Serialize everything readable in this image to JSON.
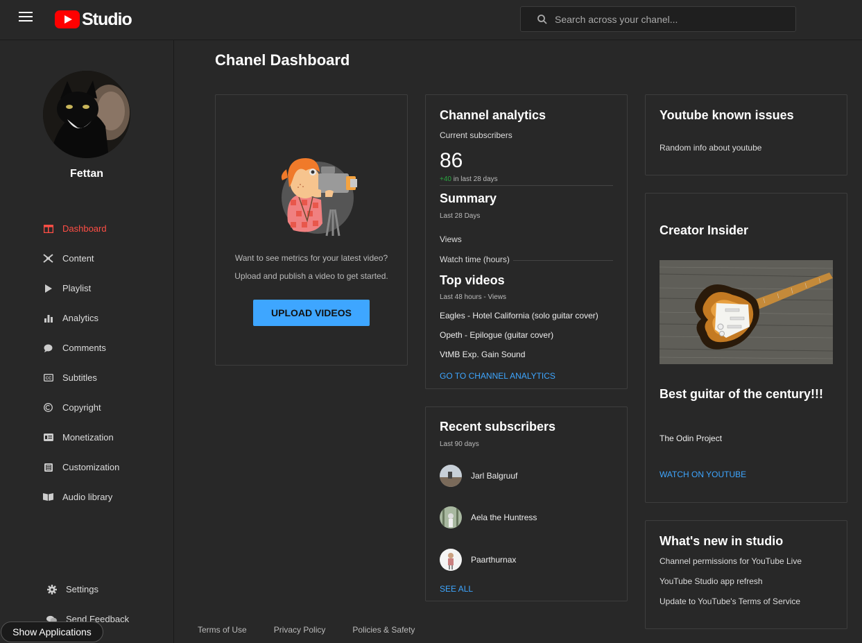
{
  "app": {
    "logo_word": "Studio"
  },
  "search": {
    "placeholder": "Search across your chanel..."
  },
  "sidebar": {
    "username": "Fettan",
    "items": [
      {
        "label": "Dashboard",
        "icon": "dashboard-icon",
        "active": true
      },
      {
        "label": "Content",
        "icon": "content-icon"
      },
      {
        "label": "Playlist",
        "icon": "playlist-icon"
      },
      {
        "label": "Analytics",
        "icon": "analytics-icon"
      },
      {
        "label": "Comments",
        "icon": "comments-icon"
      },
      {
        "label": "Subtitles",
        "icon": "subtitles-icon"
      },
      {
        "label": "Copyright",
        "icon": "copyright-icon"
      },
      {
        "label": "Monetization",
        "icon": "monetization-icon"
      },
      {
        "label": "Customization",
        "icon": "customization-icon"
      },
      {
        "label": "Audio library",
        "icon": "audio-library-icon"
      }
    ],
    "bottom_items": [
      {
        "label": "Settings",
        "icon": "gear-icon"
      },
      {
        "label": "Send Feedback",
        "icon": "feedback-icon"
      }
    ],
    "show_apps": "Show Applications"
  },
  "main": {
    "title": "Chanel Dashboard",
    "upload": {
      "line1": "Want to see metrics for your latest video?",
      "line2": "Upload and publish a video to get started.",
      "button": "UPLOAD VIDEOS"
    },
    "analytics": {
      "title": "Channel analytics",
      "subs_label": "Current subscribers",
      "subs_value": "86",
      "subs_delta": "+40",
      "subs_period": "in last 28 days",
      "summary_title": "Summary",
      "summary_period": "Last 28 Days",
      "views_label": "Views",
      "watch_label": "Watch time (hours)",
      "top_title": "Top videos",
      "top_period": "Last 48 hours - Views",
      "top_videos": [
        "Eagles - Hotel California (solo guitar cover)",
        "Opeth - Epilogue (guitar cover)",
        "VtMB Exp. Gain Sound"
      ],
      "link": "GO TO CHANNEL ANALYTICS"
    },
    "recent": {
      "title": "Recent subscribers",
      "period": "Last 90 days",
      "subscribers": [
        "Jarl Balgruuf",
        "Aela the Huntress",
        "Paarthurnax"
      ],
      "link": "SEE ALL"
    },
    "issues": {
      "title": "Youtube known issues",
      "text": "Random info about youtube"
    },
    "creator": {
      "title": "Creator Insider",
      "headline": "Best guitar of the century!!!",
      "source": "The Odin Project",
      "link": "WATCH ON YOUTUBE"
    },
    "whatsnew": {
      "title": "What's new in studio",
      "items": [
        "Channel permissions for YouTube Live",
        "YouTube Studio app refresh",
        "Update to YouTube's Terms of Service"
      ]
    }
  },
  "footer": {
    "links": [
      "Terms of Use",
      "Privacy Policy",
      "Policies & Safety"
    ]
  },
  "colors": {
    "accent": "#ff4e45",
    "link": "#3ea6ff",
    "positive": "#2ba640",
    "background": "#282828"
  }
}
